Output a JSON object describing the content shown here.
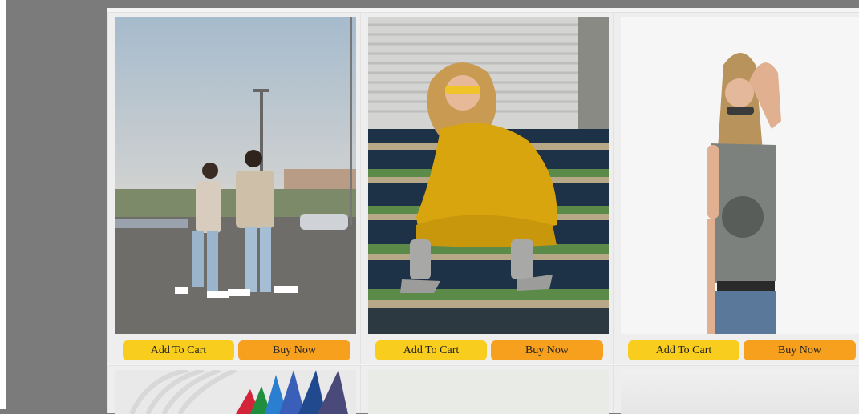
{
  "products": [
    {
      "image_alt": "Couple in jeans and plaid shirts in a parking lot",
      "add_to_cart": "Add To Cart",
      "buy_now": "Buy Now"
    },
    {
      "image_alt": "Woman in yellow dress sitting on steps",
      "add_to_cart": "Add To Cart",
      "buy_now": "Buy Now"
    },
    {
      "image_alt": "Woman in grey t-shirt and jeans",
      "add_to_cart": "Add To Cart",
      "buy_now": "Buy Now"
    }
  ],
  "colors": {
    "add_to_cart": "#f8cd1d",
    "buy_now": "#f6a01e",
    "page_background": "#7b7b7b"
  }
}
